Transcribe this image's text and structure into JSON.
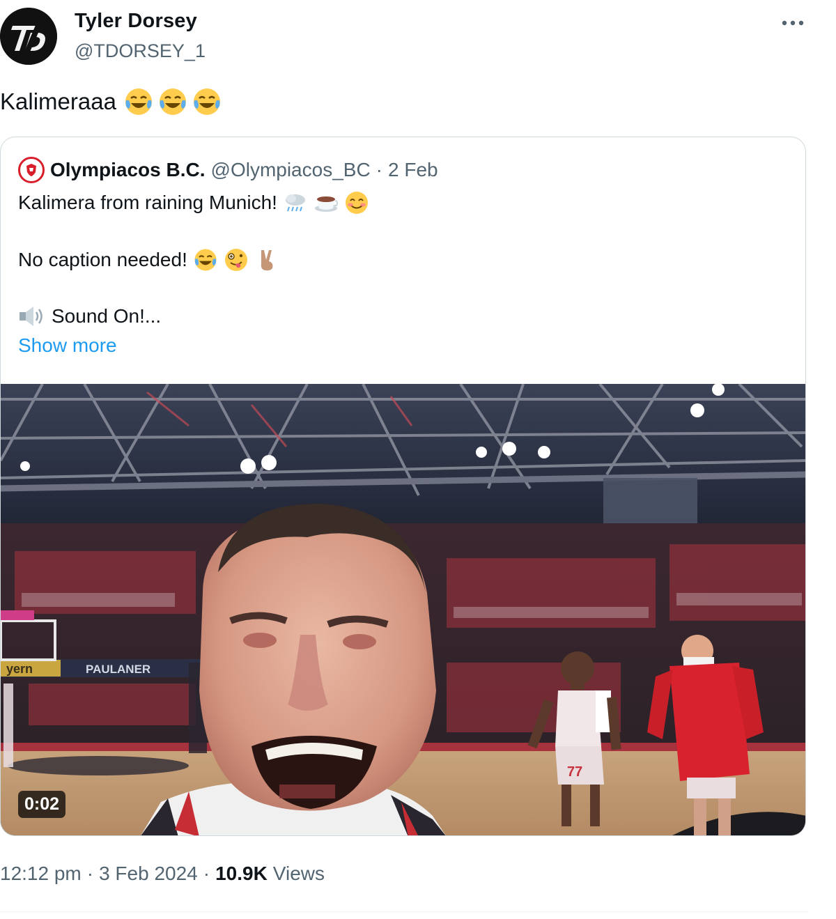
{
  "author": {
    "name": "Tyler Dorsey",
    "handle": "@TDORSEY_1",
    "avatar_icon": "td-monogram-avatar"
  },
  "tweet": {
    "text": "Kalimeraaa",
    "emojis": [
      "😂",
      "😂",
      "😂"
    ]
  },
  "more_icon": "ellipsis-icon",
  "quote": {
    "name": "Olympiacos B.C.",
    "handle": "@Olympiacos_BC",
    "separator": "·",
    "date": "2 Feb",
    "avatar_icon": "olympiacos-crest-icon",
    "line1_text": "Kalimera from raining Munich!",
    "line1_emojis": [
      "🌧️",
      "☕",
      "😊"
    ],
    "line2_text": "No caption needed!",
    "line2_emojis": [
      "😂",
      "🤪",
      "✌🏽"
    ],
    "line3_text": "Sound On!...",
    "line3_icon": "speaker-icon",
    "show_more": "Show more"
  },
  "video": {
    "duration": "0:02",
    "jersey_number": "77",
    "sponsor_text": "PAULANER",
    "banner_text": "yern"
  },
  "footer": {
    "time": "12:12 pm",
    "separator1": "·",
    "date": "3 Feb 2024",
    "separator2": "·",
    "views_count": "10.9K",
    "views_label": "Views"
  },
  "colors": {
    "link_blue": "#1d9bf0",
    "secondary_text": "#536471",
    "primary_text": "#0f1419",
    "border": "#cfd9de",
    "olympiacos_red": "#d81e2a"
  }
}
